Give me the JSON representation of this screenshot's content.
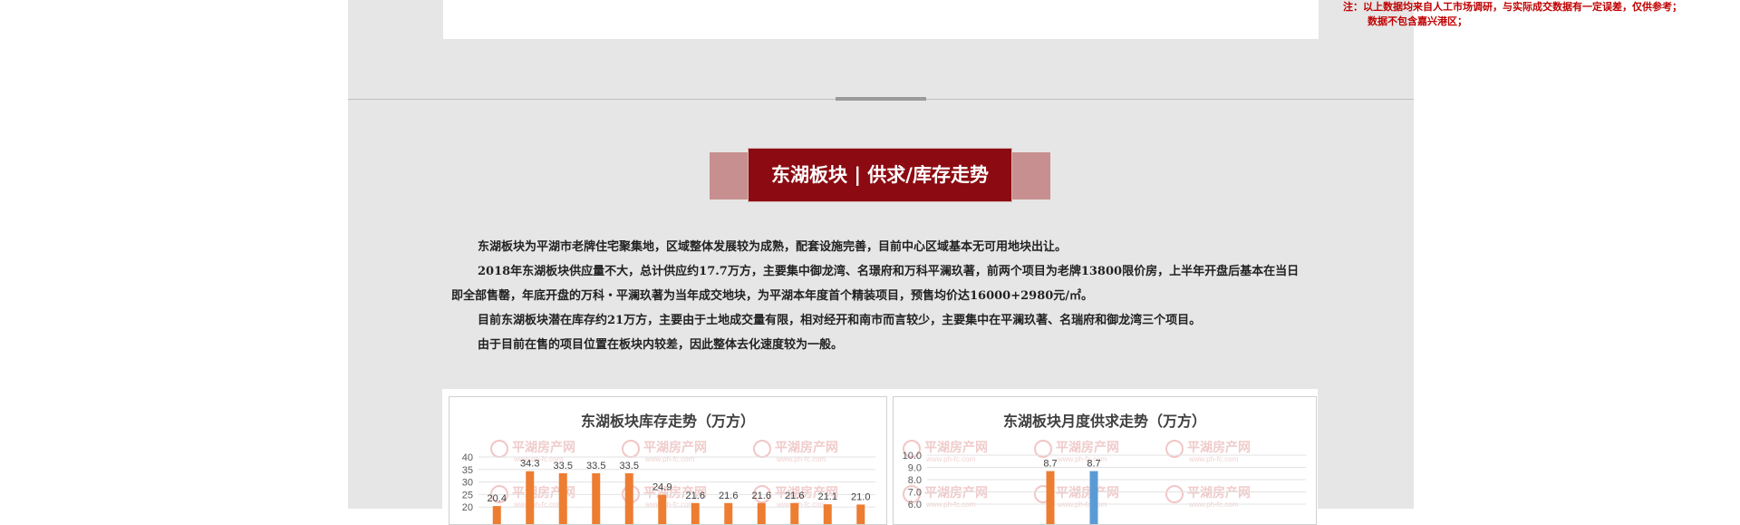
{
  "note": {
    "line1": "注：以上数据均来自人工市场调研，与实际成交数据有一定误差，仅供参考；",
    "line2": "数据不包含嘉兴港区；"
  },
  "section": {
    "title": "东湖板块 | 供求/库存走势",
    "paragraphs": [
      "东湖板块为平湖市老牌住宅聚集地，区域整体发展较为成熟，配套设施完善，目前中心区域基本无可用地块出让。",
      "2018年东湖板块供应量不大，总计供应约17.7万方，主要集中御龙湾、名璟府和万科平澜玖著，前两个项目为老牌13800限价房，上半年开盘后基本在当日即全部售罄，年底开盘的万科・平澜玖著为当年成交地块，为平湖本年度首个精装项目，预售均价达16000+2980元/㎡。",
      "目前东湖板块潜在库存约21万方，主要由于土地成交量有限，相对经开和南市而言较少，主要集中在平澜玖著、名瑞府和御龙湾三个项目。",
      "由于目前在售的项目位置在板块内较差，因此整体去化速度较为一般。"
    ]
  },
  "watermark": {
    "text": "平湖房产网",
    "url": "www.ph-fc.com"
  },
  "colors": {
    "accent_red": "#8c0b12",
    "banner_pink": "#c78f8f",
    "note_red": "#c00000",
    "bar_orange": "#ed7d31",
    "bar_blue": "#5b9bd5"
  },
  "chart_data": [
    {
      "type": "bar",
      "title": "东湖板块库存走势（万方）",
      "ylim": [
        0,
        40
      ],
      "yticks": [
        "40",
        "35",
        "30",
        "25",
        "20"
      ],
      "series": [
        {
          "values": [
            20.4,
            34.3,
            33.5,
            33.5,
            33.5,
            24.9,
            21.6,
            21.6,
            21.6,
            21.6,
            21.1,
            21.0
          ],
          "color": "#ed7d31"
        }
      ],
      "data_labels": [
        "20.4",
        "34.3",
        "33.5",
        "33.5",
        "33.5",
        "24.9",
        "21.6",
        "21.6",
        "21.6",
        "21.6",
        "21.1",
        "21.0"
      ],
      "grid": true
    },
    {
      "type": "bar",
      "title": "东湖板块月度供求走势（万方）",
      "ylim": [
        0,
        10
      ],
      "yticks": [
        "10.0",
        "9.0",
        "8.0",
        "7.0",
        "6.0"
      ],
      "series": [
        {
          "values": [
            8.7
          ],
          "color": "#ed7d31"
        },
        {
          "values": [
            8.7
          ],
          "color": "#5b9bd5"
        }
      ],
      "data_labels": [
        "8.7",
        "8.7"
      ],
      "grid": true
    }
  ]
}
